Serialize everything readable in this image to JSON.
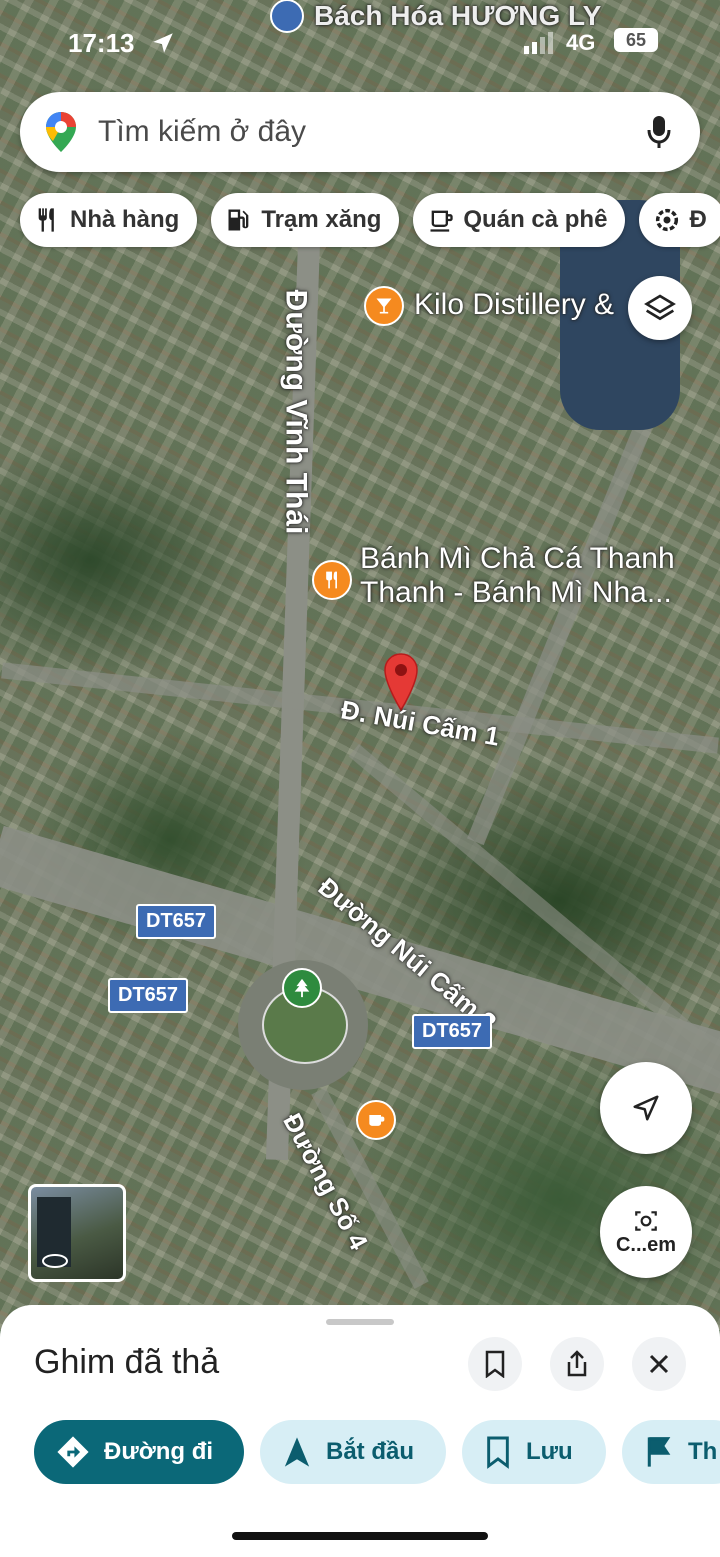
{
  "status": {
    "time": "17:13",
    "network": "4G",
    "battery": "65",
    "top_place": "Bách Hóa HƯƠNG LY"
  },
  "search": {
    "placeholder": "Tìm kiếm ở đây"
  },
  "chips": [
    {
      "label": "Nhà hàng",
      "icon": "fork-knife-icon"
    },
    {
      "label": "Trạm xăng",
      "icon": "gas-station-icon"
    },
    {
      "label": "Quán cà phê",
      "icon": "coffee-icon"
    },
    {
      "label": "Đ",
      "icon": "settings-icon"
    }
  ],
  "map": {
    "places": {
      "bar": "Kilo Distillery &",
      "bakery_line1": "Bánh Mì Chả Cá Thanh",
      "bakery_line2": "Thanh - Bánh Mì Nha..."
    },
    "streets": {
      "vinh_thai": "Đường Vĩnh Thái",
      "nui_cam_1": "Đ. Núi Cấm 1",
      "nui_cam_2": "Đường Núi Cấm 2",
      "so_4": "Đường Số 4"
    },
    "route_badges": [
      "DT657",
      "DT657",
      "DT657"
    ],
    "streetview_label": "C...em"
  },
  "sheet": {
    "title": "Ghim đã thả",
    "actions": [
      {
        "label": "Đường đi",
        "icon": "directions-icon"
      },
      {
        "label": "Bắt đầu",
        "icon": "navigation-arrow-icon"
      },
      {
        "label": "Lưu",
        "icon": "bookmark-icon"
      },
      {
        "label": "Th",
        "icon": "flag-icon"
      }
    ]
  },
  "colors": {
    "primary": "#0b6878",
    "tonal": "#d7eef5",
    "pin": "#e53935",
    "route_badge": "#3d6bb3"
  }
}
